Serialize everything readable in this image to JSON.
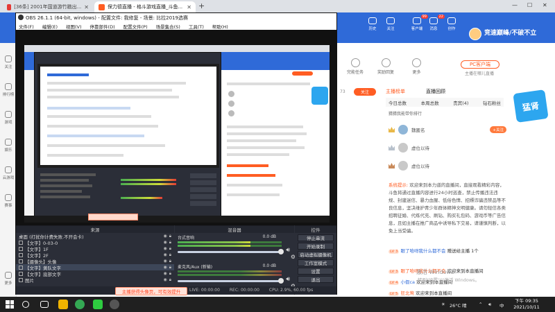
{
  "browser": {
    "tabs": [
      {
        "label": "[36条] 2001年国道游竹戳出...",
        "active": false
      },
      {
        "label": "保力德直播 - 格斗游戏直播_斗鱼...",
        "active": true
      }
    ],
    "new_tab": "+"
  },
  "site_header": {
    "nav": [
      {
        "label": "历史",
        "badge": ""
      },
      {
        "label": "关注",
        "badge": ""
      },
      {
        "label": "客户端",
        "badge": "99"
      },
      {
        "label": "消息",
        "badge": "22"
      },
      {
        "label": "创作",
        "badge": ""
      }
    ],
    "slogan": "竞速巅峰/不破不立"
  },
  "left_sidebar": [
    {
      "label": "关注",
      "icon": "heart-icon"
    },
    {
      "label": "排行榜",
      "icon": "trophy-icon"
    },
    {
      "label": "游戏",
      "icon": "gamepad-icon"
    },
    {
      "label": "娱乐",
      "icon": "music-icon"
    },
    {
      "label": "云游戏",
      "icon": "cloud-icon"
    },
    {
      "label": "赛事",
      "icon": "flag-icon"
    },
    {
      "label": "更多",
      "icon": "grid-icon"
    }
  ],
  "obs": {
    "title": "OBS 26.1.1 (64-bit, windows) - 配置文件: 我修复 - 场景: 比拉2019选赛",
    "menu": [
      "文件(F)",
      "编辑(E)",
      "视图(V)",
      "停靠部件(D)",
      "配置文件(P)",
      "场景集合(S)",
      "工具(T)",
      "帮助(H)"
    ],
    "docks": {
      "sources_title": "来源",
      "mixer_title": "混音器",
      "controls_title": "控件"
    },
    "sources": [
      {
        "label": "桌面 (打扰你计费失败.不开会卡)",
        "selected": false
      },
      {
        "label": "【文字】0-03-0",
        "selected": false
      },
      {
        "label": "【文字】1F",
        "selected": false
      },
      {
        "label": "【文字】2F",
        "selected": false
      },
      {
        "label": "【摄像头】头像",
        "selected": false
      },
      {
        "label": "【文字】黄队文字",
        "selected": true
      },
      {
        "label": "【文字】底部文字",
        "selected": false
      },
      {
        "label": "图片",
        "selected": false
      }
    ],
    "mixer": [
      {
        "name": "台式音响",
        "db": "0.0 dB",
        "level": 0.68
      },
      {
        "name": "麦克风/Aux (新输)",
        "db": "0.0 dB",
        "level": 0.0
      }
    ],
    "controls": [
      "停止串流",
      "开始录制",
      "启动虚拟摄像机",
      "工作室模式",
      "设置",
      "退出"
    ],
    "status": {
      "live": "LIVE: 00:00:00",
      "rec": "REC: 00:00:00",
      "cpu": "CPU: 2.9%, 60.00 fps"
    }
  },
  "right_panel": {
    "pc_client": "PC客户端",
    "pc_sub": "主播在哪儿直播",
    "icons": [
      {
        "label": "完能任务",
        "icon": "task-icon"
      },
      {
        "label": "奖励回复",
        "icon": "gift-icon"
      },
      {
        "label": "更多",
        "icon": "more-icon"
      }
    ],
    "follow": "关注",
    "follow_count": "73",
    "rank_tabs": [
      "主播榜单",
      "直播回顾"
    ],
    "rank_sub": [
      "今日总数",
      "本周总数",
      "贵宾(4)",
      "钻石粉丝"
    ],
    "rank_hint": "猜猜我能带你排行",
    "rank_rows": [
      {
        "name": "魏匿名",
        "follow": "+关注"
      },
      {
        "name": "虚位以待",
        "follow": ""
      },
      {
        "name": "虚位以待",
        "follow": ""
      }
    ],
    "badge": "猛肾",
    "system_label": "系统提示:",
    "system_message": "欢迎来到本力道的直播间，直接观看精彩内容，斗鱼将通过直播内容进行24小时巡查，禁止传播违法违规、封建迷信、暴力血腥、低俗色情、招嫖诈骗违禁品等不良信息，坚决维护青少年群体精神文明健康。请勿轻信各类招聘征婚、代练代充、刷钻、购买礼包码、游戏币等广告信息，且如主播在推广商品中诱导私下交易，请谨慎判断，以免上当受骗。",
    "chat": [
      {
        "level": "LV 3",
        "user": "眼了哈呀我什么都不会",
        "text": "赠送给主播 1个"
      },
      {
        "level": "LV 3",
        "user": "眼了哈呀我什么都不会",
        "text": "欢迎来到本直播间"
      },
      {
        "level": "LV 4",
        "user": "小假ca",
        "text": "欢迎来到本直播间"
      },
      {
        "level": "LV 5",
        "user": "狂北莺",
        "text": "欢迎来到本直播间"
      }
    ],
    "activate_line1": "激活 Windows",
    "activate_line2": "转到\"设置\"以激活 Windows。"
  },
  "promo": "主播获得头像页，可有效提升",
  "taskbar": {
    "weather": "26°C 晴",
    "ime": "中",
    "time": "下午 09:35",
    "date": "2021/10/11"
  }
}
